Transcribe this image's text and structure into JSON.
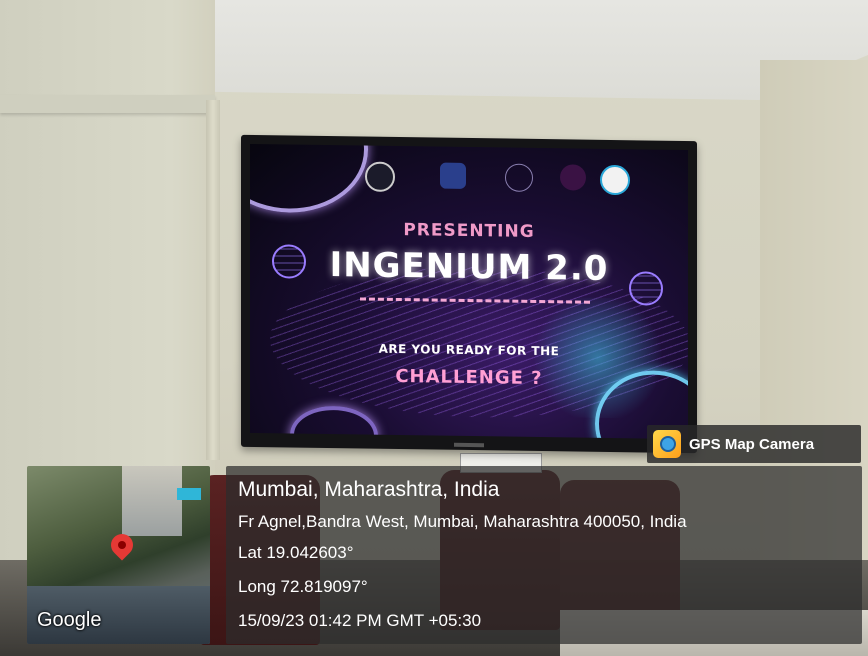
{
  "screen": {
    "presenting": "PRESENTING",
    "title": "INGENIUM 2.0",
    "question": "ARE YOU READY FOR THE",
    "challenge": "CHALLENGE ?"
  },
  "gps_badge": {
    "label": "GPS Map Camera",
    "icon": "gps-map-camera-icon"
  },
  "map": {
    "brand": "Google",
    "icon": "map-pin-icon"
  },
  "location": {
    "city": "Mumbai, Maharashtra, India",
    "address": "Fr Agnel,Bandra West, Mumbai, Maharashtra 400050, India",
    "latitude": "Lat 19.042603°",
    "longitude": "Long 72.819097°",
    "timestamp": "15/09/23 01:42 PM GMT +05:30"
  }
}
